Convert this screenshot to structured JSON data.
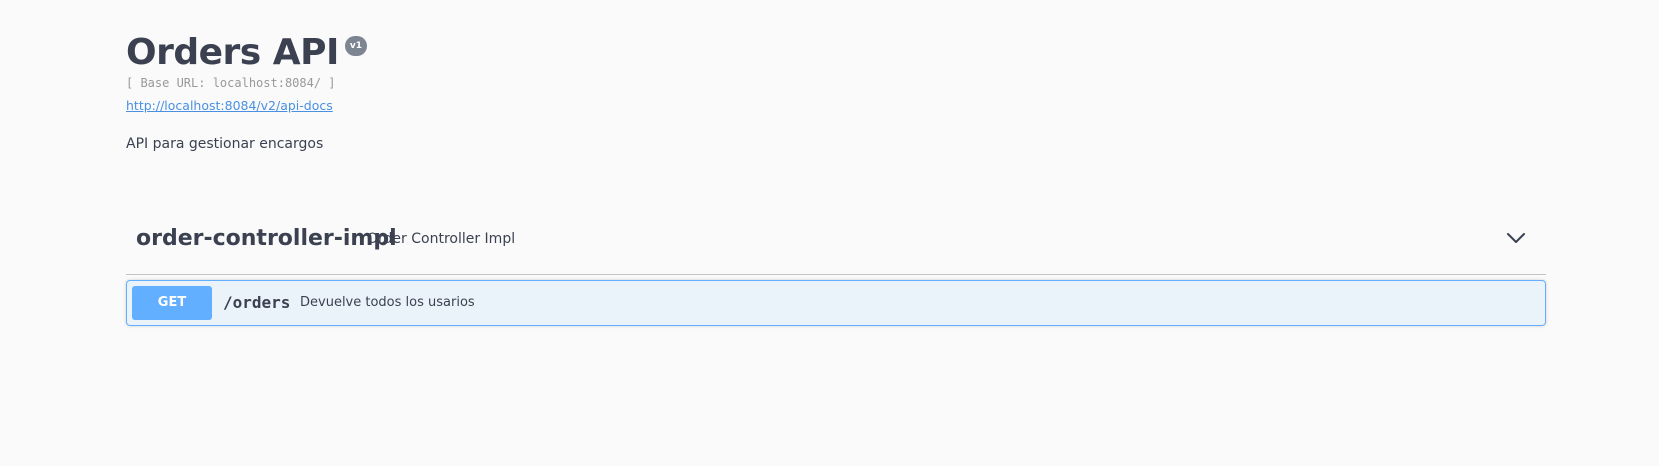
{
  "info": {
    "title": "Orders API",
    "version": "v1",
    "base_url": "[ Base URL: localhost:8084/ ]",
    "spec_link": "http://localhost:8084/v2/api-docs",
    "description": "API para gestionar encargos"
  },
  "tag": {
    "name": "order-controller-impl",
    "description": "Order Controller Impl",
    "expand_icon": "chevron-down-icon"
  },
  "operations": [
    {
      "method": "GET",
      "path": "/orders",
      "summary": "Devuelve todos los usarios"
    }
  ],
  "colors": {
    "background": "#fafafa",
    "text": "#3b4151",
    "get_method": "#61affe",
    "link": "#4990e2",
    "version_badge": "#7d8492"
  }
}
